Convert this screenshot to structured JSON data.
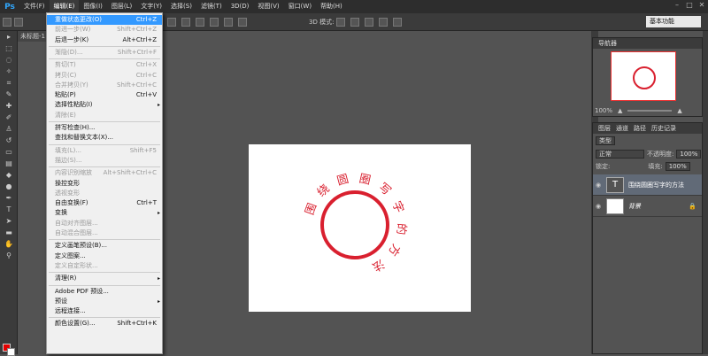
{
  "app": {
    "logo": "Ps"
  },
  "menubar": [
    "文件(F)",
    "编辑(E)",
    "图像(I)",
    "图层(L)",
    "文字(Y)",
    "选择(S)",
    "滤镜(T)",
    "3D(D)",
    "视图(V)",
    "窗口(W)",
    "帮助(H)"
  ],
  "window_controls": [
    "–",
    "□",
    "✕"
  ],
  "options_bar": {
    "mode_3d": "3D 模式:",
    "workspace": "基本功能"
  },
  "doc_tab": "未标题-1",
  "edit_menu": [
    {
      "label": "重做状态更改(O)",
      "shortcut": "Ctrl+Z",
      "state": "highlight"
    },
    {
      "label": "前进一步(W)",
      "shortcut": "Shift+Ctrl+Z",
      "state": "disabled"
    },
    {
      "label": "后退一步(K)",
      "shortcut": "Alt+Ctrl+Z",
      "state": "normal"
    },
    {
      "sep": true
    },
    {
      "label": "渐隐(D)...",
      "shortcut": "Shift+Ctrl+F",
      "state": "disabled"
    },
    {
      "sep": true
    },
    {
      "label": "剪切(T)",
      "shortcut": "Ctrl+X",
      "state": "disabled"
    },
    {
      "label": "拷贝(C)",
      "shortcut": "Ctrl+C",
      "state": "disabled"
    },
    {
      "label": "合并拷贝(Y)",
      "shortcut": "Shift+Ctrl+C",
      "state": "disabled"
    },
    {
      "label": "粘贴(P)",
      "shortcut": "Ctrl+V",
      "state": "normal"
    },
    {
      "label": "选择性粘贴(I)",
      "shortcut": "",
      "state": "normal",
      "submenu": true
    },
    {
      "label": "清除(E)",
      "shortcut": "",
      "state": "disabled"
    },
    {
      "sep": true
    },
    {
      "label": "拼写检查(H)...",
      "shortcut": "",
      "state": "normal"
    },
    {
      "label": "查找和替换文本(X)...",
      "shortcut": "",
      "state": "normal"
    },
    {
      "sep": true
    },
    {
      "label": "填充(L)...",
      "shortcut": "Shift+F5",
      "state": "disabled"
    },
    {
      "label": "描边(S)...",
      "shortcut": "",
      "state": "disabled"
    },
    {
      "sep": true
    },
    {
      "label": "内容识别缩放",
      "shortcut": "Alt+Shift+Ctrl+C",
      "state": "disabled"
    },
    {
      "label": "操控变形",
      "shortcut": "",
      "state": "normal"
    },
    {
      "label": "透视变形",
      "shortcut": "",
      "state": "disabled"
    },
    {
      "label": "自由变换(F)",
      "shortcut": "Ctrl+T",
      "state": "normal"
    },
    {
      "label": "变换",
      "shortcut": "",
      "state": "normal",
      "submenu": true
    },
    {
      "label": "自动对齐图层...",
      "shortcut": "",
      "state": "disabled"
    },
    {
      "label": "自动混合图层...",
      "shortcut": "",
      "state": "disabled"
    },
    {
      "sep": true
    },
    {
      "label": "定义画笔预设(B)...",
      "shortcut": "",
      "state": "normal"
    },
    {
      "label": "定义图案...",
      "shortcut": "",
      "state": "normal"
    },
    {
      "label": "定义自定形状...",
      "shortcut": "",
      "state": "disabled"
    },
    {
      "sep": true
    },
    {
      "label": "清理(R)",
      "shortcut": "",
      "state": "normal",
      "submenu": true
    },
    {
      "sep": true
    },
    {
      "label": "Adobe PDF 预设...",
      "shortcut": "",
      "state": "normal"
    },
    {
      "label": "预设",
      "shortcut": "",
      "state": "normal",
      "submenu": true
    },
    {
      "label": "远程连接...",
      "shortcut": "",
      "state": "normal"
    },
    {
      "sep": true
    },
    {
      "label": "颜色设置(G)...",
      "shortcut": "Shift+Ctrl+K",
      "state": "normal"
    }
  ],
  "canvas": {
    "arc_text": "围绕圆圈写字的方法",
    "circle_color": "#d9202f"
  },
  "navigator": {
    "tab": "导航器",
    "zoom": "100%"
  },
  "layers_panel": {
    "tabs": [
      "图层",
      "通道",
      "路径",
      "历史记录"
    ],
    "filter": "类型",
    "blend_mode": "正常",
    "opacity_label": "不透明度:",
    "opacity": "100%",
    "lock_label": "锁定:",
    "fill_label": "填充:",
    "fill": "100%",
    "layers": [
      {
        "name": "围绕圆圈写字的方法",
        "type": "text",
        "selected": true
      },
      {
        "name": "背景",
        "type": "background",
        "selected": false
      }
    ]
  }
}
